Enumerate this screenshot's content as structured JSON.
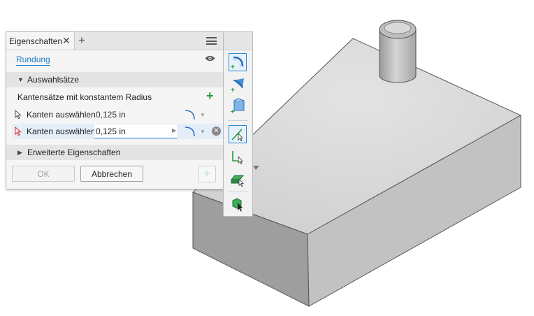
{
  "panel": {
    "tab_title": "Eigenschaften",
    "close_glyph": "✕",
    "add_tab_glyph": "+",
    "menu_icon": "hamburger-menu-icon",
    "command_name": "Rundung",
    "visibility_icon": "eye-icon",
    "selection_section": {
      "title": "Auswahlsätze",
      "expanded": true,
      "subtitle": "Kantensätze mit konstantem Radius",
      "add_glyph": "+",
      "rows": [
        {
          "label": "Kanten auswählen",
          "value": "0,125 in",
          "active": false
        },
        {
          "label": "Kanten auswählen",
          "value": "0,125 in",
          "active": true
        }
      ]
    },
    "advanced_section": {
      "title": "Erweiterte Eigenschaften",
      "expanded": false
    },
    "buttons": {
      "ok": "OK",
      "cancel": "Abbrechen",
      "apply_glyph": "+"
    }
  },
  "toolbar": {
    "items": [
      {
        "name": "constant-fillet-icon",
        "selected": true
      },
      {
        "name": "variable-fillet-icon",
        "selected": false
      },
      {
        "name": "face-fillet-icon",
        "selected": false
      },
      {
        "name": "select-edge-icon",
        "selected": true
      },
      {
        "name": "select-loop-icon",
        "selected": false
      },
      {
        "name": "select-feature-icon",
        "selected": false
      },
      {
        "name": "select-solid-icon",
        "selected": false
      }
    ]
  },
  "colors": {
    "accent": "#1b7fc4",
    "add_green": "#1f9b3a",
    "model_top": "#d7d7d7",
    "model_left": "#9c9c9c",
    "model_right": "#c1c1c1",
    "active_row": "#e3eef9",
    "background": "#ffffff"
  }
}
